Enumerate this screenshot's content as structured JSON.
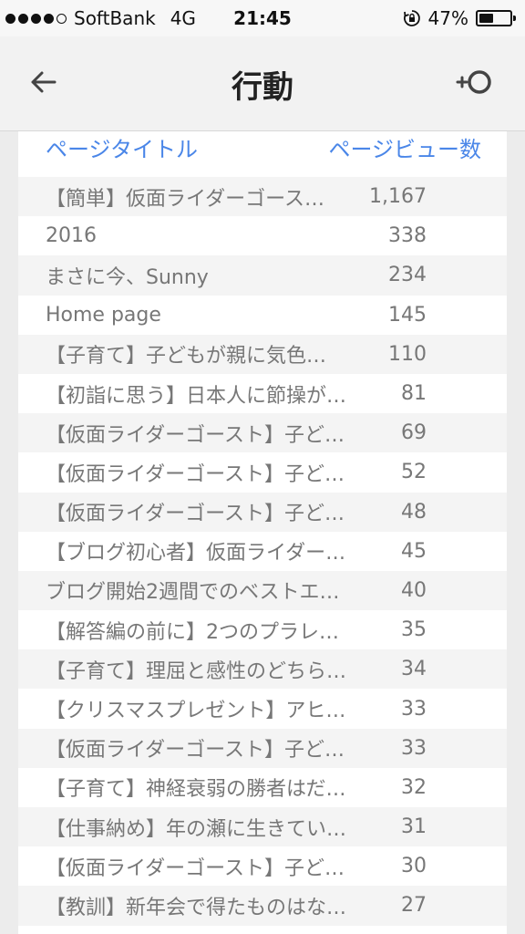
{
  "status_bar": {
    "carrier": "SoftBank",
    "network": "4G",
    "time": "21:45",
    "battery": "47%",
    "battery_level": 0.47,
    "signal_bars": 4,
    "signal_max": 5
  },
  "nav": {
    "title": "行動",
    "back_icon": "arrow-left-icon",
    "refresh_icon": "refresh-icon"
  },
  "table": {
    "header_title": "ページタイトル",
    "header_views": "ページビュー数",
    "rows": [
      {
        "title": "【簡単】仮面ライダーゴース…",
        "views": "1,167"
      },
      {
        "title": "2016",
        "views": "338"
      },
      {
        "title": "まさに今、Sunny",
        "views": "234"
      },
      {
        "title": "Home page",
        "views": "145"
      },
      {
        "title": "【子育て】子どもが親に気色…",
        "views": "110"
      },
      {
        "title": "【初詣に思う】日本人に節操が…",
        "views": "81"
      },
      {
        "title": "【仮面ライダーゴースト】子ど…",
        "views": "69"
      },
      {
        "title": "【仮面ライダーゴースト】子ど…",
        "views": "52"
      },
      {
        "title": "【仮面ライダーゴースト】子ど…",
        "views": "48"
      },
      {
        "title": "【ブログ初心者】仮面ライダー…",
        "views": "45"
      },
      {
        "title": "ブログ開始2週間でのベストエ…",
        "views": "40"
      },
      {
        "title": "【解答編の前に】2つのプラレ…",
        "views": "35"
      },
      {
        "title": "【子育て】理屈と感性のどちら…",
        "views": "34"
      },
      {
        "title": "【クリスマスプレゼント】アヒ…",
        "views": "33"
      },
      {
        "title": "【仮面ライダーゴースト】子ど…",
        "views": "33"
      },
      {
        "title": "【子育て】神経衰弱の勝者はだ…",
        "views": "32"
      },
      {
        "title": "【仕事納め】年の瀬に生きてい…",
        "views": "31"
      },
      {
        "title": "【仮面ライダーゴースト】子ど…",
        "views": "30"
      },
      {
        "title": "【教訓】新年会で得たものはな…",
        "views": "27"
      }
    ]
  }
}
